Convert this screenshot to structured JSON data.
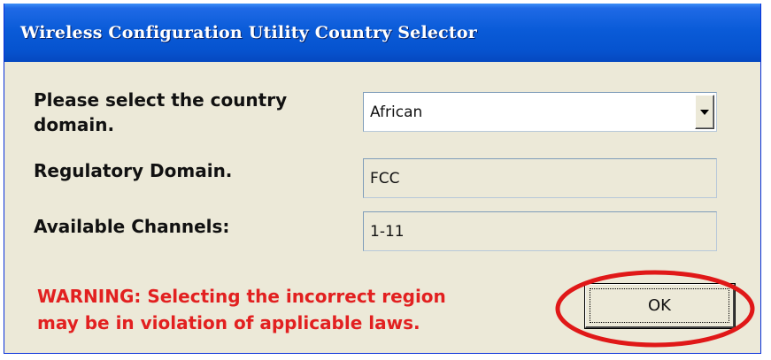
{
  "window": {
    "title": "Wireless Configuration Utility Country Selector"
  },
  "form": {
    "country_label": "Please select the country domain.",
    "country_value": "African",
    "regulatory_label": "Regulatory Domain.",
    "regulatory_value": "FCC",
    "channels_label": "Available Channels:",
    "channels_value": "1-11"
  },
  "warning": {
    "line1": "WARNING: Selecting the incorrect region",
    "line2": "may be in violation of applicable laws."
  },
  "buttons": {
    "ok_label": "OK"
  },
  "annotation": {
    "ring_color": "#e01818"
  },
  "icons": {
    "dropdown": "chevron-down-icon"
  }
}
